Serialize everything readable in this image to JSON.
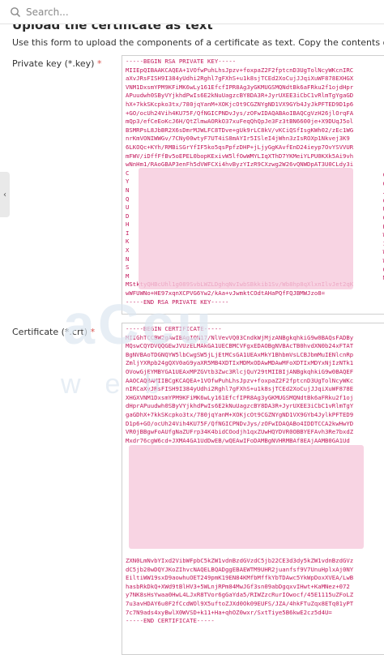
{
  "search": {
    "placeholder": "Search..."
  },
  "page": {
    "heading": "Upload the certificate as text",
    "description": "Use this form to upload the components of a certificate as text. Copy the contents of a file and paste into the cor"
  },
  "private_key": {
    "label": "Private key (*.key)",
    "required": "*",
    "lines": [
      "-----BEGIN RSA PRIVATE KEY-----",
      "MIIEpQIBAAKCAQEA+1VOfwPuhLhsJpzv+foxpaZ2F2fptcnD3UgTolNcyWKcnIRC",
      "aXvJRsFISH9I384yUdhi2Rghl7gFXhS+u1k8sjTCEd2XoCujJJqiXuWF878EXHGX",
      "VNM1DxsmYPM9KFiMK6wLy161EfcfIPR8Ag3yGKMUGSMQNdtBk6aFRku2f1ojdHpr",
      "APuudwh0SByVYjkhdPwIs6E2kNuUagzcBY8DA3R+JyrUXEE3iCbC1vRlmTgYgaGD",
      "hX+7kkSKcpko3tx/780jqYanM+XOKjcOt9CGZNYgND1VX9GYb4JyJkPFTED9D1p6",
      "+GO/ocUh24Vih4KU75F/QfNGICPNDvJys/zOFwIDAQABAoIBAQCgVzH26jlOrqFA",
      "mQp3/efCeEoKcJ6H/QtZlmwAORkO37xuFeqQhQpJe3Fz3tBN6600je+X9DUqJ5ol",
      "BSMRPsL8JbBR2X6sDmrMJWLFC8TDve+gUk9rLC8kV/vKCiQSfIsgKWh02/zEc1WG",
      "nrKmVONIWWGv/7CNy00wtyF7UT4iS8mAYIr5ISleI4jWhn3zIsROXp1Nkvej3K9",
      "6LKOQc+KYh/RMBiSGrYfIF5ko5qsPpfzDHP+jLjyGgKAvfEnD24ieyp7OvYSVVUR",
      "mFWV/iDffFfBv5oEPEL0bopKExivW5lfOwWMYLIqXThD7YKMeiYLPU0KXk5Ai9vh",
      "wNnHm1/RAoGBAP3enFh5dVWFCXi4hvByzYIzR9CXzwg2W26vQNWDpAT3U0CLdy3i",
      "C",
      "Y",
      "N",
      "Q",
      "U",
      "D",
      "H",
      "I",
      "K",
      "X",
      "N",
      "S",
      "M",
      "MStktyQHBcUhl1g089SvbLWZLDghqNvIwbSBkkib1Sv/Wb8hp8qXlxnIlvJet2qK",
      "wWFUWNo+HE97xqnXCPVG6Yw2/kAa+vJwmktCOdtAHaPQfFQJBMWJzo8=",
      "-----END RSA PRIVATE KEY-----"
    ],
    "lines_right": [
      "C",
      "G",
      "J",
      "C",
      "U",
      "G",
      "H",
      "W",
      "I",
      "W",
      "W",
      "G",
      "M"
    ]
  },
  "certificate": {
    "label": "Certificate (*.crt)",
    "required": "*",
    "lines": [
      "-----BEGIN CERTIFICATE-----",
      "MIIGhTCCBW2gAwIBAgIQN17/NlVevVQ03CndkWjMjzANBgkqhkiG9w0BAQsFADBy",
      "MQswCQYDVQQGEwJVUzELMAkGA1UECBMCVFgxEDAOBgNVBAcTB0hvdXN0b24xFTAT",
      "BgNVBAoTDGNQYW5lbCwgSW5jLjEtMCsGA1UEAxMkY1BhbmVsLCBJbmMuIENlcnRp",
      "ZmljYXRpb24gQXV0aG9yaXR5MB4XDTIxMDMxODAwMDAwMFoXDTIxMDYxNjIzNTk1",
      "OVowGjEYMBYGA1UEAxMPZGVtb3Zwc3RlcjQuY29tMIIBIjANBgkqhkiG9w0BAQEF",
      "AAOCAQ8AMIIBCgKCAQEA+1VOfwPuhLhsJpzv+foxpaZ2F2fptcnD3UgTolNcyWKc",
      "nIRCaXvJRsFISH9I384yUdhi2Rghl7gFXhS+u1k8sjTCEd2XoCujJJqiXuWF878E",
      "XHGXVNM1DxsmYPM9KFiMK6wLy161EfcfIPR8Ag3yGKMUGSMQNdtBk6aFRku2f1oj",
      "dHprAPuudwh0SByVYjkhdPwIs6E2kNuUagzcBY8DA3R+JyrUXEE3iCbC1vRlmTgY",
      "gaGDhX+7kkSKcpko3tx/780jqYanM+XOKjcOt9CGZNYgND1VX9GYb4JylkPFTED9",
      "D1p6+GO/ocUh24Vih4KU75F/QfNGICPNDvJys/zOFwIDAQABo4IDDTCCA2kwHwYD",
      "VR0jBBgwFoAUfgNaZUFrp34K4bidCOodjh1qxZUwHQYDVR0OBBYEFAvh3Re7bxdZ",
      "Mxdr76cgW6cd+JXMA4GA1UdDwEB/wQEAwIFoDAMBgNVHRMBAf8EAjAAMB0GA1Ud",
      "",
      "",
      "",
      "",
      "",
      "",
      "",
      "",
      "",
      "",
      "",
      "",
      "",
      "ZXN0LmNvbYIxd2VibWFpbC5kZW1vdnBzdGVzdC5jb22CE3d3dy5kZW1vdnBzdGVz",
      "dC5jb20wDQYJKoZIhvcNAQELBQADggEBAEWTM9UHR2juanfsf9V7UnuHplxAj0NY",
      "EiltiWW19sxD9aowhuOET249pmK19EN84KMfbMffkYbTDAwc5YkWpDoxXVEA/LwB",
      "hasbRkDkQ+XWd9tBlHV3+5WLnjRPm84MwJGf3sn09abDgqxvIHwt+KaMNez+072",
      "y7NK8sHsYwaa0HwL4LJxR8TVor6gGaYda5/RIWZzcRurIOwocf/45E1115uZFoLZ",
      "7u3avHDAY6u0F2fCcdWOl9X5uftoZJXd0Ok09EUFS/JZA/4hkFTuZqx8ETq01yPT",
      "7c7N9ads4xyBwlX0WVSD+k11+Ha+qhOZ0wxr/SxtTiye5B6kwE2cz5d4U=",
      "-----END CERTIFICATE-----"
    ]
  },
  "colors": {
    "code_text": "#c2185b",
    "redaction": "#f6c9dc",
    "required_marker": "#d9534f"
  },
  "icons": {
    "search": "search-icon",
    "side_tab": "chevron-left-icon"
  }
}
